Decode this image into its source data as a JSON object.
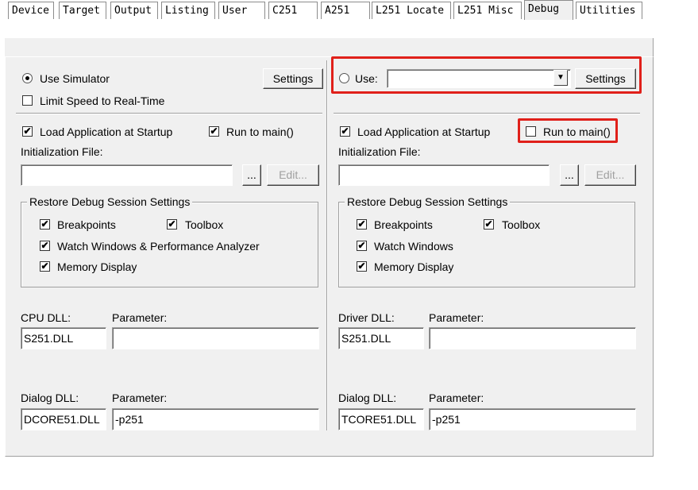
{
  "tabs": [
    "Device",
    "Target",
    "Output",
    "Listing",
    "User",
    "C251",
    "A251",
    "L251 Locate",
    "L251 Misc",
    "Debug",
    "Utilities"
  ],
  "active_tab": "Debug",
  "left": {
    "use_simulator": "Use Simulator",
    "limit_speed": "Limit Speed to Real-Time",
    "settings": "Settings",
    "load_app": "Load Application at Startup",
    "run_to_main": "Run to main()",
    "init_file_label": "Initialization File:",
    "browse": "...",
    "edit": "Edit...",
    "restore_group": "Restore Debug Session Settings",
    "breakpoints": "Breakpoints",
    "toolbox": "Toolbox",
    "watch": "Watch Windows & Performance Analyzer",
    "memory": "Memory Display",
    "cpu_dll_label": "CPU DLL:",
    "cpu_param_label": "Parameter:",
    "cpu_dll": "S251.DLL",
    "cpu_param": "",
    "dialog_dll_label": "Dialog DLL:",
    "dialog_param_label": "Parameter:",
    "dialog_dll": "DCORE51.DLL",
    "dialog_param": "-p251"
  },
  "right": {
    "use": "Use:",
    "use_value": "",
    "settings": "Settings",
    "load_app": "Load Application at Startup",
    "run_to_main": "Run to main()",
    "init_file_label": "Initialization File:",
    "browse": "...",
    "edit": "Edit...",
    "restore_group": "Restore Debug Session Settings",
    "breakpoints": "Breakpoints",
    "toolbox": "Toolbox",
    "watch": "Watch Windows",
    "memory": "Memory Display",
    "driver_dll_label": "Driver DLL:",
    "driver_param_label": "Parameter:",
    "driver_dll": "S251.DLL",
    "driver_param": "",
    "dialog_dll_label": "Dialog DLL:",
    "dialog_param_label": "Parameter:",
    "dialog_dll": "TCORE51.DLL",
    "dialog_param": "-p251"
  },
  "check_glyph": "✔",
  "highlight_color": "#e0201a"
}
